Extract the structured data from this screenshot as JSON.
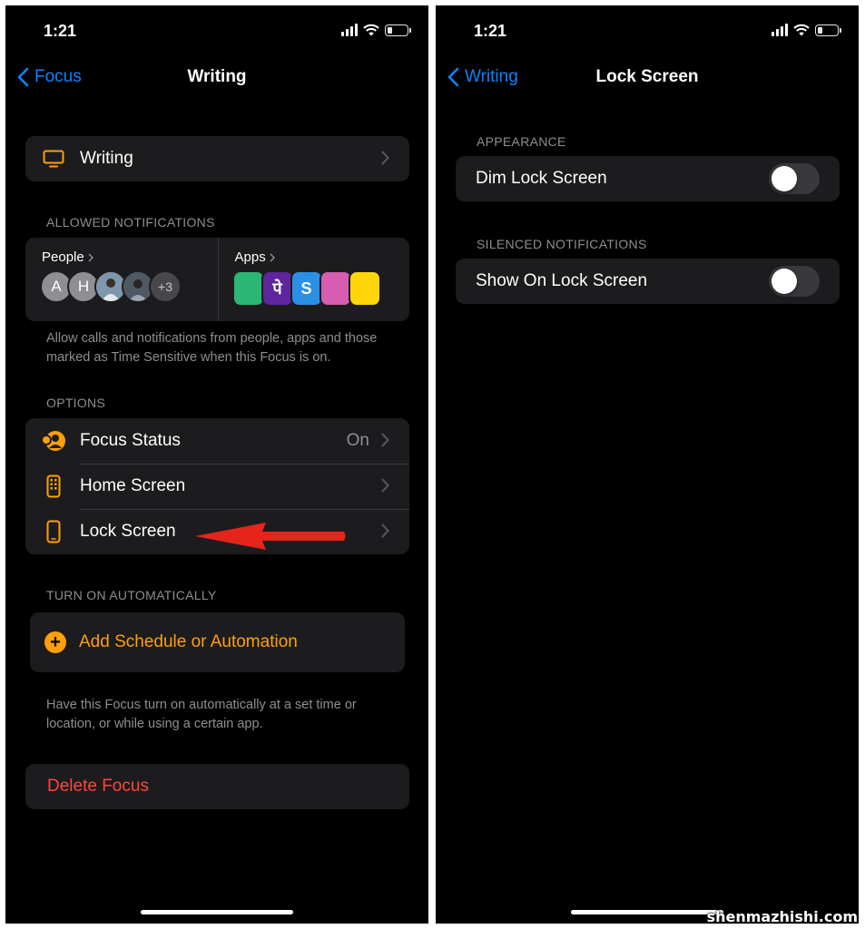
{
  "left_screen": {
    "status": {
      "time": "1:21"
    },
    "nav": {
      "back_label": "Focus",
      "title": "Writing"
    },
    "focus_name_row": {
      "label": "Writing",
      "icon": "display-icon"
    },
    "allowed_notifications": {
      "header": "ALLOWED NOTIFICATIONS",
      "people_label": "People",
      "people": [
        "A",
        "H",
        "",
        ""
      ],
      "people_more": "+3",
      "apps_label": "Apps",
      "apps": [
        {
          "glyph": "",
          "color": "#2bb673"
        },
        {
          "glyph": "पे",
          "color": "#5f259f"
        },
        {
          "glyph": "S",
          "color": "#2b8fe5"
        },
        {
          "glyph": "",
          "color": "#d65db1"
        },
        {
          "glyph": "",
          "color": "#ffd60a"
        }
      ],
      "footnote": "Allow calls and notifications from people, apps and those marked as Time Sensitive when this Focus is on."
    },
    "options": {
      "header": "OPTIONS",
      "focus_status": {
        "label": "Focus Status",
        "value": "On"
      },
      "home_screen": {
        "label": "Home Screen"
      },
      "lock_screen": {
        "label": "Lock Screen"
      }
    },
    "automation": {
      "header": "TURN ON AUTOMATICALLY",
      "add_label": "Add Schedule or Automation",
      "footnote": "Have this Focus turn on automatically at a set time or location, or while using a certain app."
    },
    "delete_label": "Delete Focus"
  },
  "right_screen": {
    "status": {
      "time": "1:21"
    },
    "nav": {
      "back_label": "Writing",
      "title": "Lock Screen"
    },
    "appearance": {
      "header": "APPEARANCE",
      "dim_label": "Dim Lock Screen",
      "dim_on": false
    },
    "silenced": {
      "header": "SILENCED NOTIFICATIONS",
      "show_label": "Show On Lock Screen",
      "show_on": false
    }
  },
  "colors": {
    "accent": "#ff9f0a",
    "link": "#0a84ff",
    "destructive": "#ff453a",
    "annotation_arrow": "#e5241b"
  },
  "watermark": "shenmazhishi.com"
}
